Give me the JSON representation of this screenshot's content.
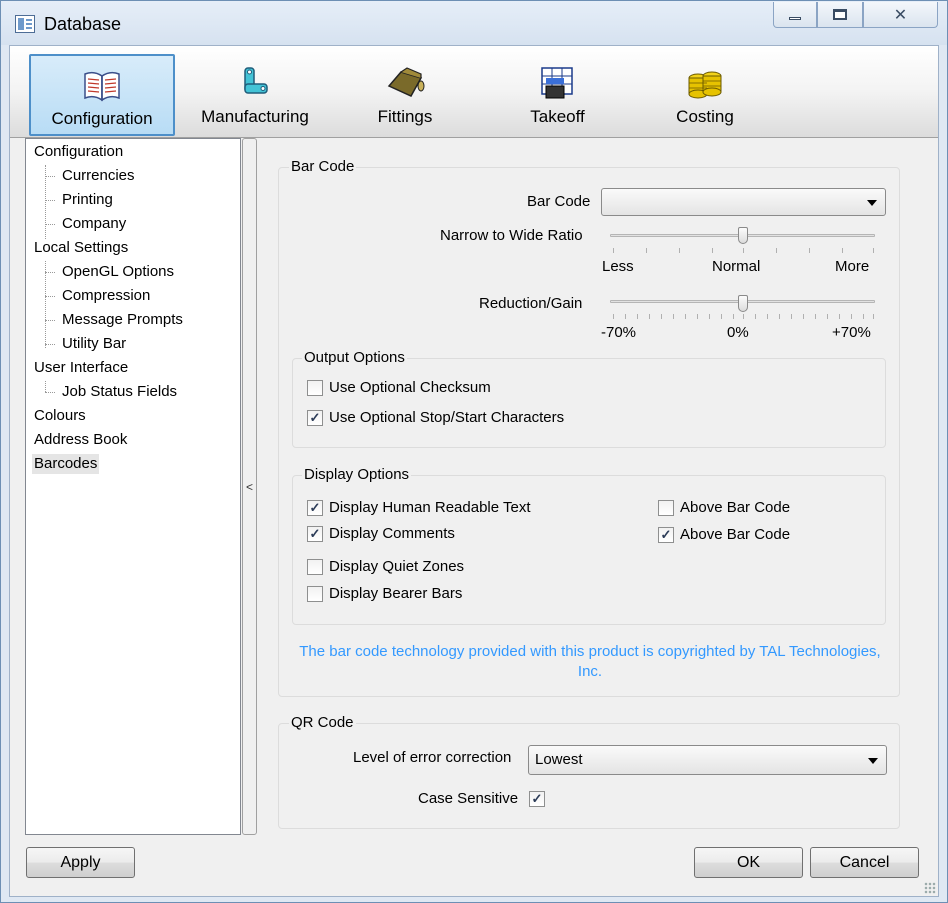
{
  "window": {
    "title": "Database"
  },
  "toolbar": {
    "items": [
      {
        "label": "Configuration",
        "icon": "book-icon",
        "active": true
      },
      {
        "label": "Manufacturing",
        "icon": "manufacturing-icon",
        "active": false
      },
      {
        "label": "Fittings",
        "icon": "fittings-icon",
        "active": false
      },
      {
        "label": "Takeoff",
        "icon": "takeoff-icon",
        "active": false
      },
      {
        "label": "Costing",
        "icon": "coins-icon",
        "active": false
      }
    ]
  },
  "tree": {
    "items": [
      {
        "label": "Configuration",
        "level": 0
      },
      {
        "label": "Currencies",
        "level": 1
      },
      {
        "label": "Printing",
        "level": 1
      },
      {
        "label": "Company",
        "level": 1
      },
      {
        "label": "Local Settings",
        "level": 0
      },
      {
        "label": "OpenGL Options",
        "level": 1
      },
      {
        "label": "Compression",
        "level": 1
      },
      {
        "label": "Message Prompts",
        "level": 1
      },
      {
        "label": "Utility Bar",
        "level": 1
      },
      {
        "label": "User Interface",
        "level": 0
      },
      {
        "label": "Job Status Fields",
        "level": 1
      },
      {
        "label": "Colours",
        "level": 0
      },
      {
        "label": "Address Book",
        "level": 0
      },
      {
        "label": "Barcodes",
        "level": 0,
        "selected": true
      }
    ]
  },
  "splitter": {
    "glyph": "<"
  },
  "barcode": {
    "group_title": "Bar Code",
    "bar_code_label": "Bar Code",
    "bar_code_value": "",
    "ratio_label": "Narrow to Wide Ratio",
    "ratio_ticks": [
      "Less",
      "Normal",
      "More"
    ],
    "ratio_value": 0.5,
    "reduction_label": "Reduction/Gain",
    "reduction_ticks": [
      "-70%",
      "0%",
      "+70%"
    ],
    "reduction_value": 0,
    "output": {
      "title": "Output Options",
      "checksum_label": "Use Optional Checksum",
      "checksum_checked": false,
      "stopstart_label": "Use Optional Stop/Start Characters",
      "stopstart_checked": true
    },
    "display": {
      "title": "Display Options",
      "human_label": "Display Human Readable Text",
      "human_checked": true,
      "comments_label": "Display Comments",
      "comments_checked": true,
      "quiet_label": "Display Quiet Zones",
      "quiet_checked": false,
      "bearer_label": "Display Bearer Bars",
      "bearer_checked": false,
      "above1_label": "Above Bar Code",
      "above1_checked": false,
      "above2_label": "Above Bar Code",
      "above2_checked": true
    },
    "notice": "The bar code technology provided with this product is copyrighted by TAL Technologies, Inc."
  },
  "qrcode": {
    "group_title": "QR Code",
    "error_label": "Level of error correction",
    "error_value": "Lowest",
    "case_label": "Case Sensitive",
    "case_checked": true
  },
  "buttons": {
    "apply": "Apply",
    "ok": "OK",
    "cancel": "Cancel"
  }
}
